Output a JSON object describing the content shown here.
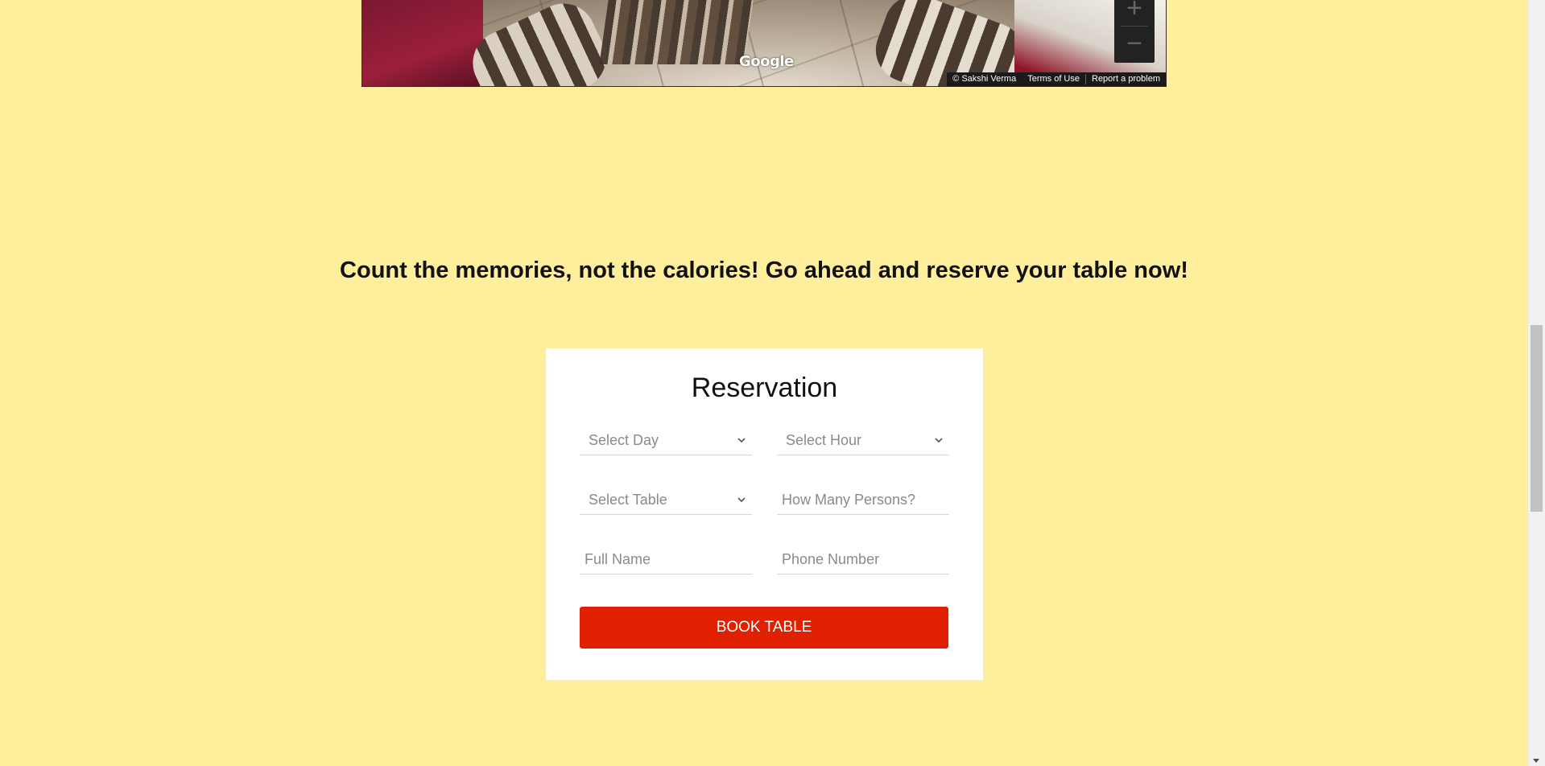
{
  "map": {
    "google_logo": "Google",
    "attribution": "© Sakshi Verma",
    "terms": "Terms of Use",
    "report": "Report a problem",
    "zoom_in": "+",
    "zoom_out": "−"
  },
  "headline": "Count the memories, not the calories! Go ahead and reserve your table now!",
  "reservation": {
    "title": "Reservation",
    "day_placeholder": "Select Day",
    "hour_placeholder": "Select Hour",
    "table_placeholder": "Select Table",
    "persons_placeholder": "How Many Persons?",
    "name_placeholder": "Full Name",
    "phone_placeholder": "Phone Number",
    "submit_label": "BOOK TABLE"
  },
  "colors": {
    "page_background": "#ffee9b",
    "button": "#e02000"
  }
}
